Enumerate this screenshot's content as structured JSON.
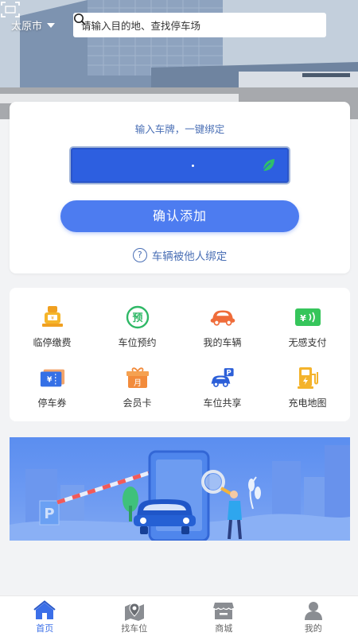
{
  "header": {
    "city": "太原市",
    "search_placeholder": "请输入目的地、查找停车场"
  },
  "bind_card": {
    "tip": "输入车牌，一键绑定",
    "confirm_label": "确认添加",
    "other_bind_label": "车辆被他人绑定"
  },
  "services": [
    {
      "label": "临停缴费",
      "icon": "parking-meter-icon"
    },
    {
      "label": "车位预约",
      "icon": "reserve-icon"
    },
    {
      "label": "我的车辆",
      "icon": "car-icon"
    },
    {
      "label": "无感支付",
      "icon": "contactless-pay-icon"
    },
    {
      "label": "停车券",
      "icon": "ticket-icon"
    },
    {
      "label": "会员卡",
      "icon": "member-card-icon"
    },
    {
      "label": "车位共享",
      "icon": "share-parking-icon"
    },
    {
      "label": "充电地图",
      "icon": "charging-icon"
    }
  ],
  "tabbar": {
    "items": [
      {
        "label": "首页",
        "icon": "home-icon",
        "active": true
      },
      {
        "label": "找车位",
        "icon": "find-parking-icon",
        "active": false
      },
      {
        "label": "商城",
        "icon": "store-icon",
        "active": false
      },
      {
        "label": "我的",
        "icon": "profile-icon",
        "active": false
      }
    ]
  },
  "colors": {
    "accent": "#4d7cf0",
    "plate_blue": "#2d5fe0",
    "link_blue": "#4a6fb5",
    "tab_active": "#3b6fe8"
  }
}
